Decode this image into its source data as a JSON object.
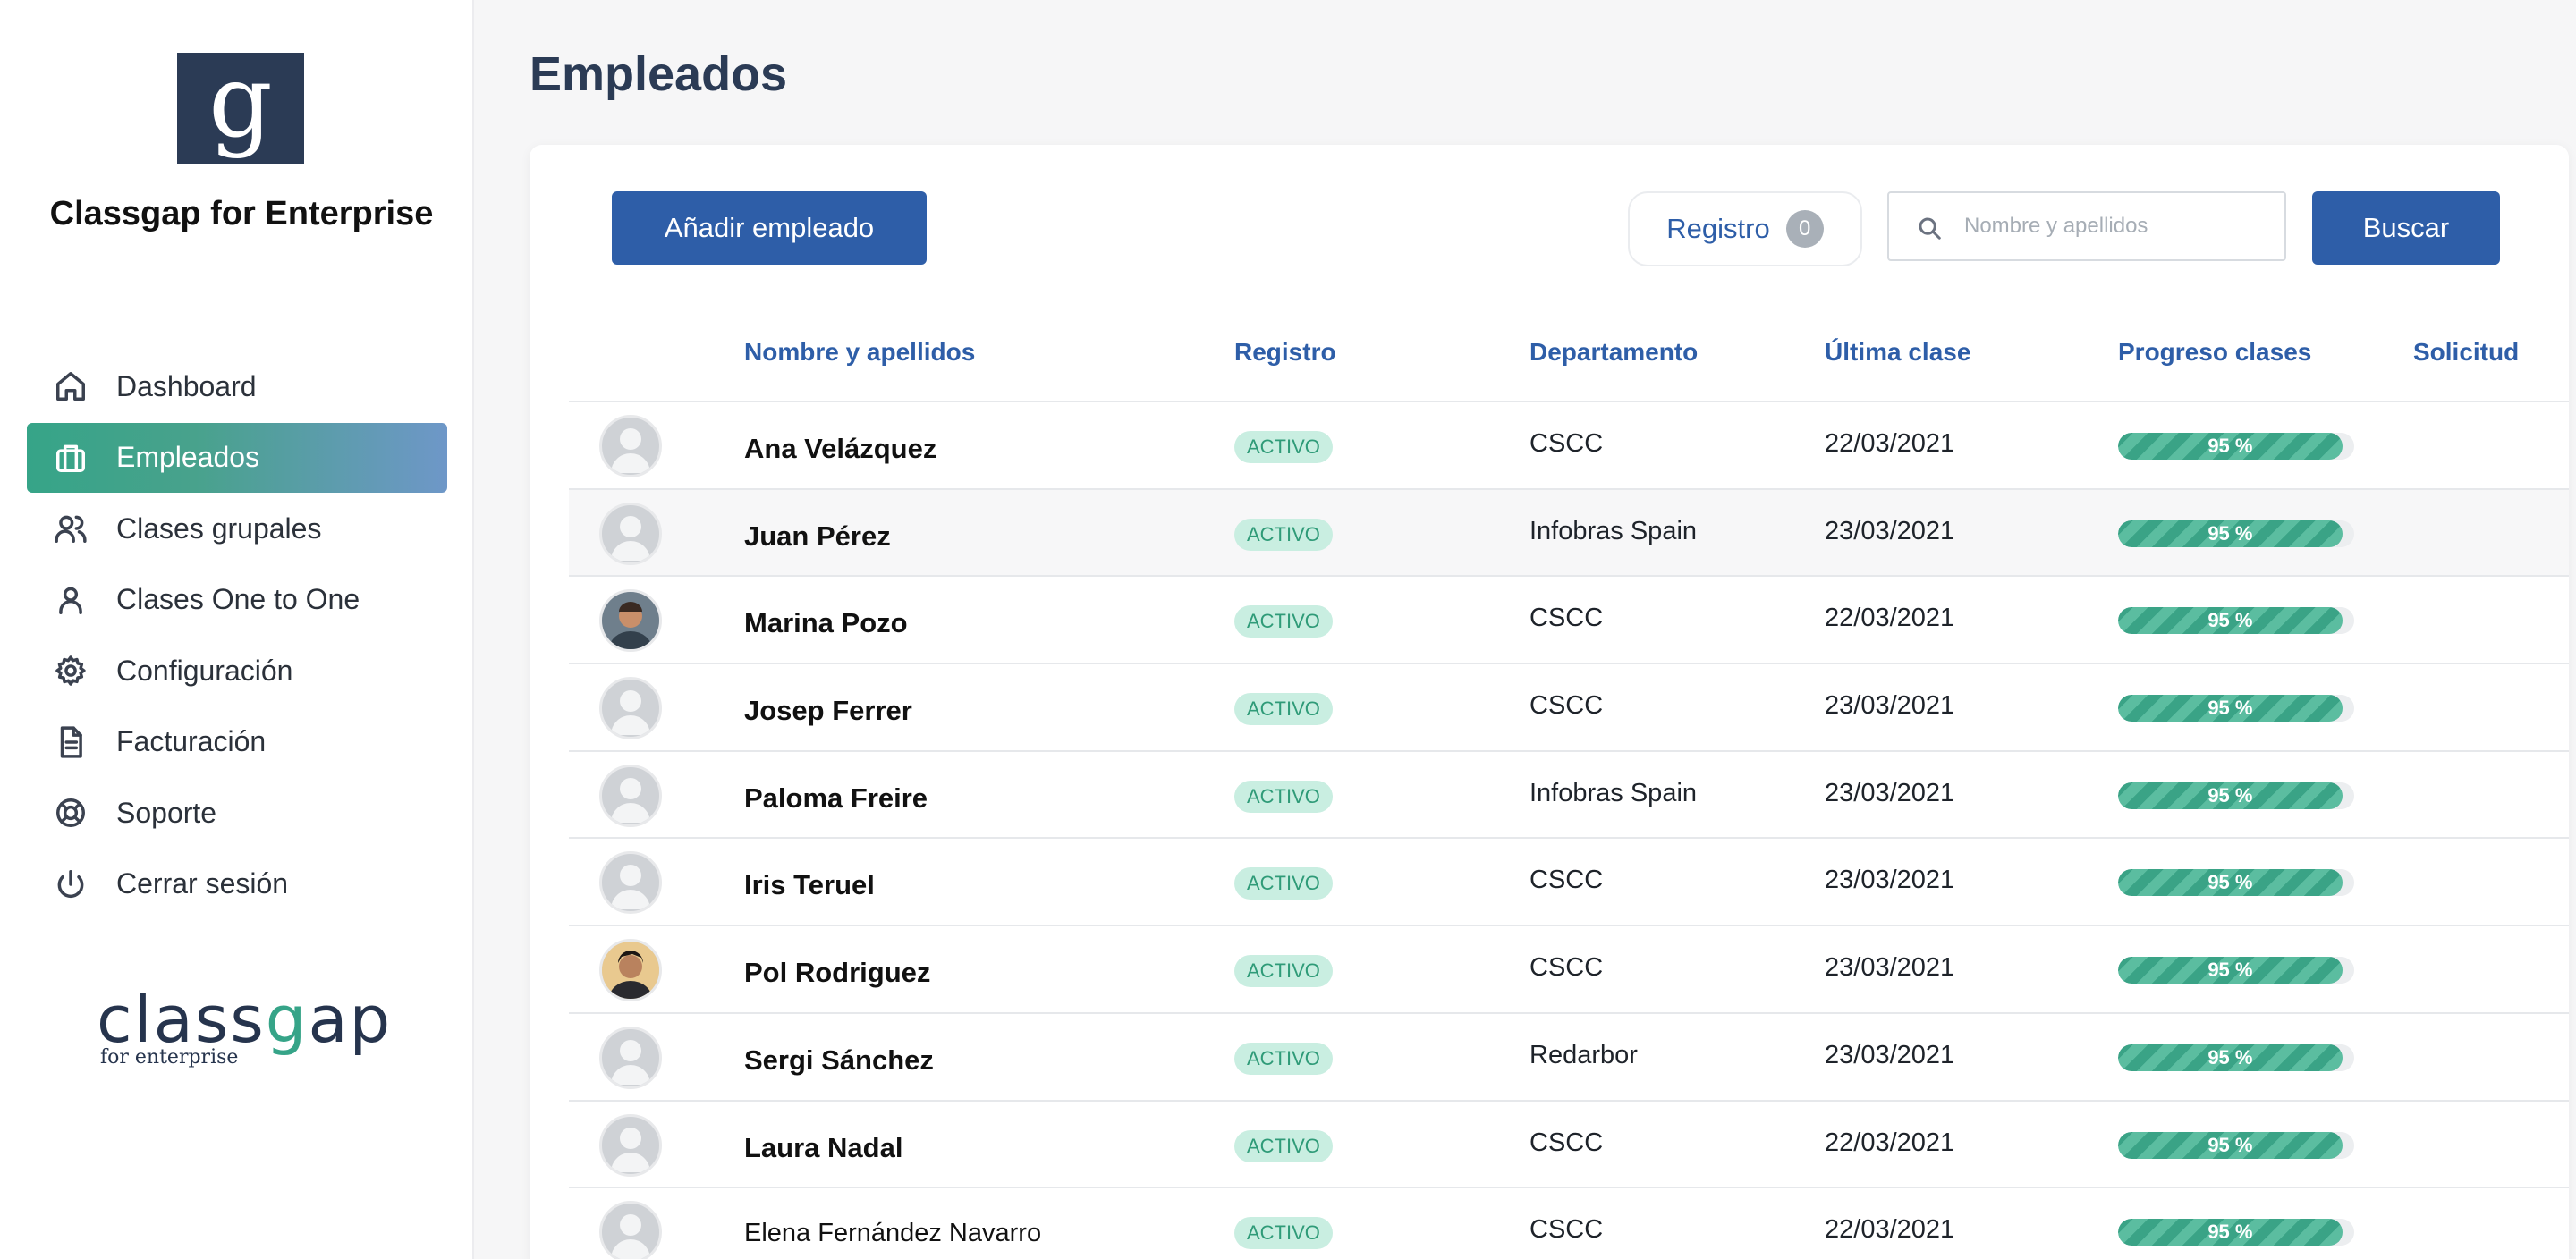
{
  "sidebar": {
    "brand": "Classgap for Enterprise",
    "logo_letter": "g",
    "items": [
      {
        "label": "Dashboard",
        "icon": "home-icon"
      },
      {
        "label": "Empleados",
        "icon": "briefcase-icon",
        "active": true
      },
      {
        "label": "Clases grupales",
        "icon": "users-icon"
      },
      {
        "label": "Clases One to One",
        "icon": "user-icon"
      },
      {
        "label": "Configuración",
        "icon": "gear-icon"
      },
      {
        "label": "Facturación",
        "icon": "document-icon"
      },
      {
        "label": "Soporte",
        "icon": "lifebuoy-icon"
      },
      {
        "label": "Cerrar sesión",
        "icon": "power-icon"
      }
    ],
    "footer_logo": {
      "word_pre": "class",
      "word_g": "g",
      "word_post": "ap",
      "sub": "for enterprise"
    }
  },
  "page": {
    "title": "Empleados"
  },
  "toolbar": {
    "add_label": "Añadir empleado",
    "registro_label": "Registro",
    "registro_count": "0",
    "search_placeholder": "Nombre y apellidos",
    "search_label": "Buscar"
  },
  "table": {
    "columns": [
      "Nombre y apellidos",
      "Registro",
      "Departamento",
      "Última clase",
      "Progreso clases",
      "Solicitud"
    ],
    "rows": [
      {
        "name": "Ana Velázquez",
        "status": "ACTIVO",
        "department": "CSCC",
        "last_class": "22/03/2021",
        "progress": 95,
        "progress_label": "95 %",
        "avatar": "placeholder"
      },
      {
        "name": "Juan Pérez",
        "status": "ACTIVO",
        "department": "Infobras Spain",
        "last_class": "23/03/2021",
        "progress": 95,
        "progress_label": "95 %",
        "avatar": "placeholder"
      },
      {
        "name": "Marina Pozo",
        "status": "ACTIVO",
        "department": "CSCC",
        "last_class": "22/03/2021",
        "progress": 95,
        "progress_label": "95 %",
        "avatar": "photo"
      },
      {
        "name": "Josep Ferrer",
        "status": "ACTIVO",
        "department": "CSCC",
        "last_class": "23/03/2021",
        "progress": 95,
        "progress_label": "95 %",
        "avatar": "placeholder"
      },
      {
        "name": "Paloma Freire",
        "status": "ACTIVO",
        "department": "Infobras Spain",
        "last_class": "23/03/2021",
        "progress": 95,
        "progress_label": "95 %",
        "avatar": "placeholder"
      },
      {
        "name": "Iris Teruel",
        "status": "ACTIVO",
        "department": "CSCC",
        "last_class": "23/03/2021",
        "progress": 95,
        "progress_label": "95 %",
        "avatar": "placeholder"
      },
      {
        "name": "Pol Rodriguez",
        "status": "ACTIVO",
        "department": "CSCC",
        "last_class": "23/03/2021",
        "progress": 95,
        "progress_label": "95 %",
        "avatar": "photo"
      },
      {
        "name": "Sergi Sánchez",
        "status": "ACTIVO",
        "department": "Redarbor",
        "last_class": "23/03/2021",
        "progress": 95,
        "progress_label": "95 %",
        "avatar": "placeholder"
      },
      {
        "name": "Laura Nadal",
        "status": "ACTIVO",
        "department": "CSCC",
        "last_class": "22/03/2021",
        "progress": 95,
        "progress_label": "95 %",
        "avatar": "placeholder"
      },
      {
        "name": "Elena Fernández Navarro",
        "status": "ACTIVO",
        "department": "CSCC",
        "last_class": "22/03/2021",
        "progress": 95,
        "progress_label": "95 %",
        "avatar": "placeholder"
      }
    ]
  },
  "colors": {
    "primary": "#2e5ea8",
    "accent": "#36a488",
    "sidebar_text": "#2b313a",
    "title": "#2b3b55"
  }
}
